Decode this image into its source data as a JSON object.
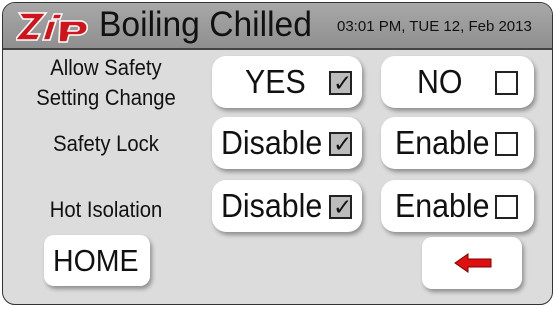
{
  "header": {
    "logo_text": "Zip",
    "title": "Boiling Chilled",
    "datetime": "03:01 PM, TUE 12, Feb 2013"
  },
  "settings": [
    {
      "label_line1": "Allow Safety",
      "label_line2": "Setting Change",
      "option_a": {
        "label": "YES",
        "checked": true
      },
      "option_b": {
        "label": "NO",
        "checked": false
      }
    },
    {
      "label_line1": "Safety Lock",
      "option_a": {
        "label": "Disable",
        "checked": true
      },
      "option_b": {
        "label": "Enable",
        "checked": false
      }
    },
    {
      "label_line1": "Hot Isolation",
      "option_a": {
        "label": "Disable",
        "checked": true
      },
      "option_b": {
        "label": "Enable",
        "checked": false
      }
    }
  ],
  "check_mark": "✓",
  "footer": {
    "home_label": "HOME",
    "back_icon": "left-arrow-icon"
  },
  "colors": {
    "logo_red": "#d0141c",
    "arrow_red": "#e01010",
    "header_bg": "#999999",
    "panel_bg": "#dcdcdc"
  }
}
